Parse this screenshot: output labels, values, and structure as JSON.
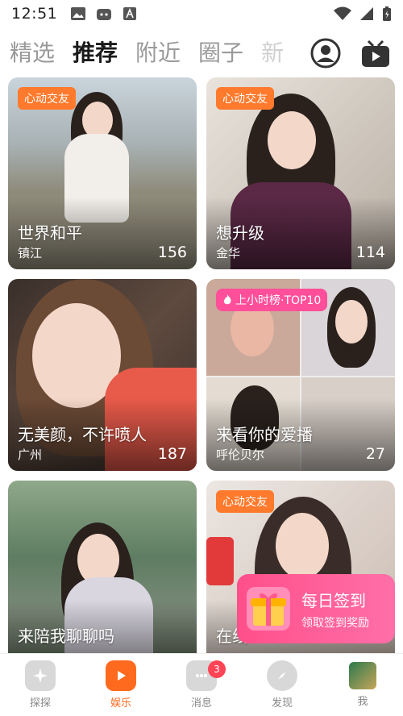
{
  "status": {
    "time": "12:51"
  },
  "tabs": [
    "精选",
    "推荐",
    "附近",
    "圈子",
    "新"
  ],
  "cards": [
    {
      "badge": "心动交友",
      "title": "世界和平",
      "city": "镇江",
      "count": "156"
    },
    {
      "badge": "心动交友",
      "title": "想升级",
      "city": "金华",
      "count": "114"
    },
    {
      "badge": "",
      "title": "无美颜，不许喷人",
      "city": "广州",
      "count": "187"
    },
    {
      "badge": "上小时榜·TOP10",
      "title": "来看你的爱播",
      "city": "呼伦贝尔",
      "count": "27"
    },
    {
      "badge": "",
      "title": "来陪我聊聊吗",
      "city": "",
      "count": ""
    },
    {
      "badge": "心动交友",
      "title": "在线",
      "city": "",
      "count": ""
    }
  ],
  "signin": {
    "title": "每日签到",
    "subtitle": "领取签到奖励"
  },
  "nav": [
    {
      "label": "探探"
    },
    {
      "label": "娱乐"
    },
    {
      "label": "消息",
      "badge": "3"
    },
    {
      "label": "发现"
    },
    {
      "label": "我"
    }
  ],
  "colors": {
    "accent": "#ff6a1e",
    "badge_orange": "#ff7a2d",
    "badge_pink": "#ff4f9a"
  }
}
